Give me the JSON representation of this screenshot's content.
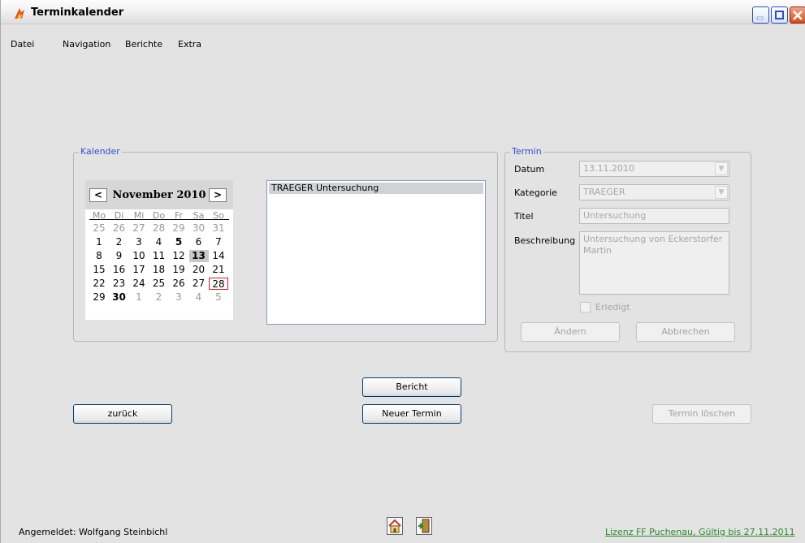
{
  "window": {
    "title": "Terminkalender"
  },
  "menu": [
    "Datei",
    "Navigation",
    "Berichte",
    "Extra"
  ],
  "calendar_group": {
    "legend": "Kalender",
    "month_label": "November 2010",
    "prev": "<",
    "next": ">",
    "weekdays": [
      "Mo",
      "Di",
      "Mi",
      "Do",
      "Fr",
      "Sa",
      "So"
    ],
    "weeks": [
      [
        {
          "d": "25",
          "o": true
        },
        {
          "d": "26",
          "o": true
        },
        {
          "d": "27",
          "o": true
        },
        {
          "d": "28",
          "o": true
        },
        {
          "d": "29",
          "o": true
        },
        {
          "d": "30",
          "o": true
        },
        {
          "d": "31",
          "o": true
        }
      ],
      [
        {
          "d": "1"
        },
        {
          "d": "2"
        },
        {
          "d": "3"
        },
        {
          "d": "4"
        },
        {
          "d": "5",
          "b": true
        },
        {
          "d": "6"
        },
        {
          "d": "7"
        }
      ],
      [
        {
          "d": "8"
        },
        {
          "d": "9"
        },
        {
          "d": "10"
        },
        {
          "d": "11"
        },
        {
          "d": "12"
        },
        {
          "d": "13",
          "s": true
        },
        {
          "d": "14"
        }
      ],
      [
        {
          "d": "15"
        },
        {
          "d": "16"
        },
        {
          "d": "17"
        },
        {
          "d": "18"
        },
        {
          "d": "19"
        },
        {
          "d": "20"
        },
        {
          "d": "21"
        }
      ],
      [
        {
          "d": "22"
        },
        {
          "d": "23"
        },
        {
          "d": "24"
        },
        {
          "d": "25"
        },
        {
          "d": "26"
        },
        {
          "d": "27"
        },
        {
          "d": "28",
          "t": true
        }
      ],
      [
        {
          "d": "29"
        },
        {
          "d": "30",
          "b": true
        },
        {
          "d": "1",
          "o": true
        },
        {
          "d": "2",
          "o": true
        },
        {
          "d": "3",
          "o": true
        },
        {
          "d": "4",
          "o": true
        },
        {
          "d": "5",
          "o": true
        }
      ]
    ],
    "appointments": [
      "TRAEGER Untersuchung"
    ]
  },
  "termin_group": {
    "legend": "Termin",
    "datum_label": "Datum",
    "datum_value": "13.11.2010",
    "kategorie_label": "Kategorie",
    "kategorie_value": "TRAEGER",
    "titel_label": "Titel",
    "titel_value": "Untersuchung",
    "beschreibung_label": "Beschreibung",
    "beschreibung_value": "Untersuchung von Eckerstorfer Martin",
    "erledigt_label": "Erledigt",
    "aendern_label": "Ändern",
    "abbrechen_label": "Abbrechen"
  },
  "buttons": {
    "bericht": "Bericht",
    "zurueck": "zurück",
    "neuer_termin": "Neuer Termin",
    "termin_loeschen": "Termin löschen"
  },
  "status": {
    "logged_in": "Angemeldet: Wolfgang Steinbichl",
    "license": "Lizenz FF Puchenau, Gültig bis 27.11.2011",
    "license_color": "#2c8a2c"
  },
  "icons": [
    "home-icon",
    "exit-door-icon"
  ]
}
